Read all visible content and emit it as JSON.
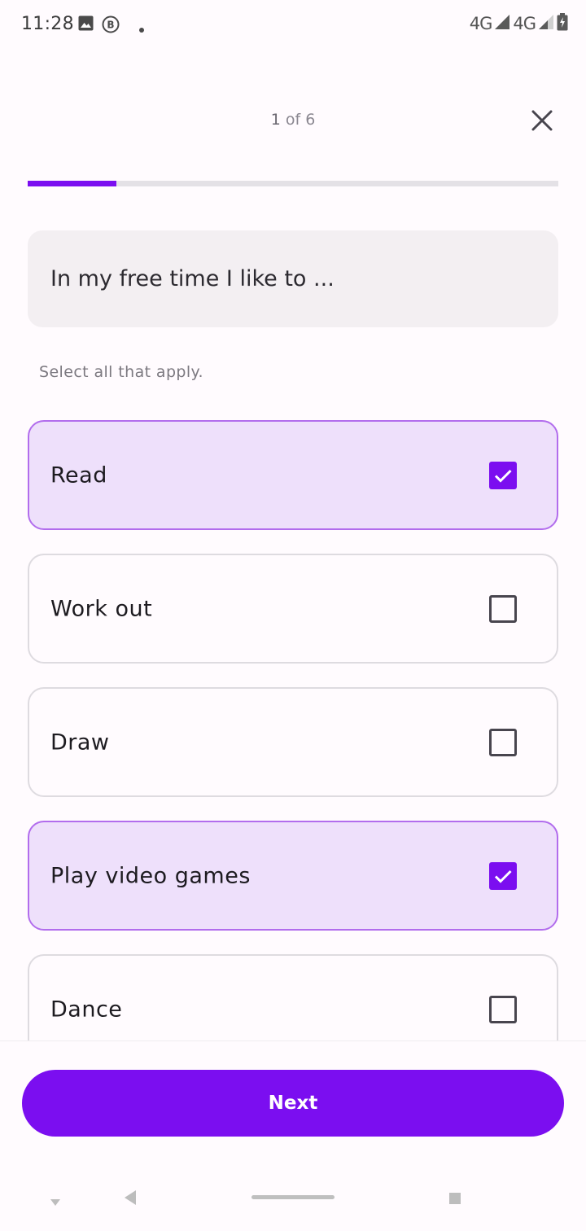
{
  "status_bar": {
    "time": "11:28",
    "network_1": "4G",
    "network_2": "4G",
    "icons": [
      "image-icon",
      "b-circle-icon",
      "dot-icon",
      "signal-icon",
      "signal-icon",
      "battery-charging-icon"
    ]
  },
  "header": {
    "step_current": "1",
    "step_suffix": " of 6",
    "close_icon": "close-icon"
  },
  "progress": {
    "current_step": 1,
    "total_steps": 6,
    "fraction": 0.167
  },
  "question": {
    "text": "In my free time I like to ...",
    "hint": "Select all that apply."
  },
  "options": [
    {
      "label": "Read",
      "checked": true
    },
    {
      "label": "Work out",
      "checked": false
    },
    {
      "label": "Draw",
      "checked": false
    },
    {
      "label": "Play video games",
      "checked": true
    },
    {
      "label": "Dance",
      "checked": false
    }
  ],
  "footer": {
    "next_label": "Next"
  },
  "colors": {
    "accent": "#7b0ef0",
    "checked_bg": "#eee0fb",
    "checked_border": "#b26ded",
    "card_bg": "#f3eff2",
    "background": "#fffbfe"
  }
}
